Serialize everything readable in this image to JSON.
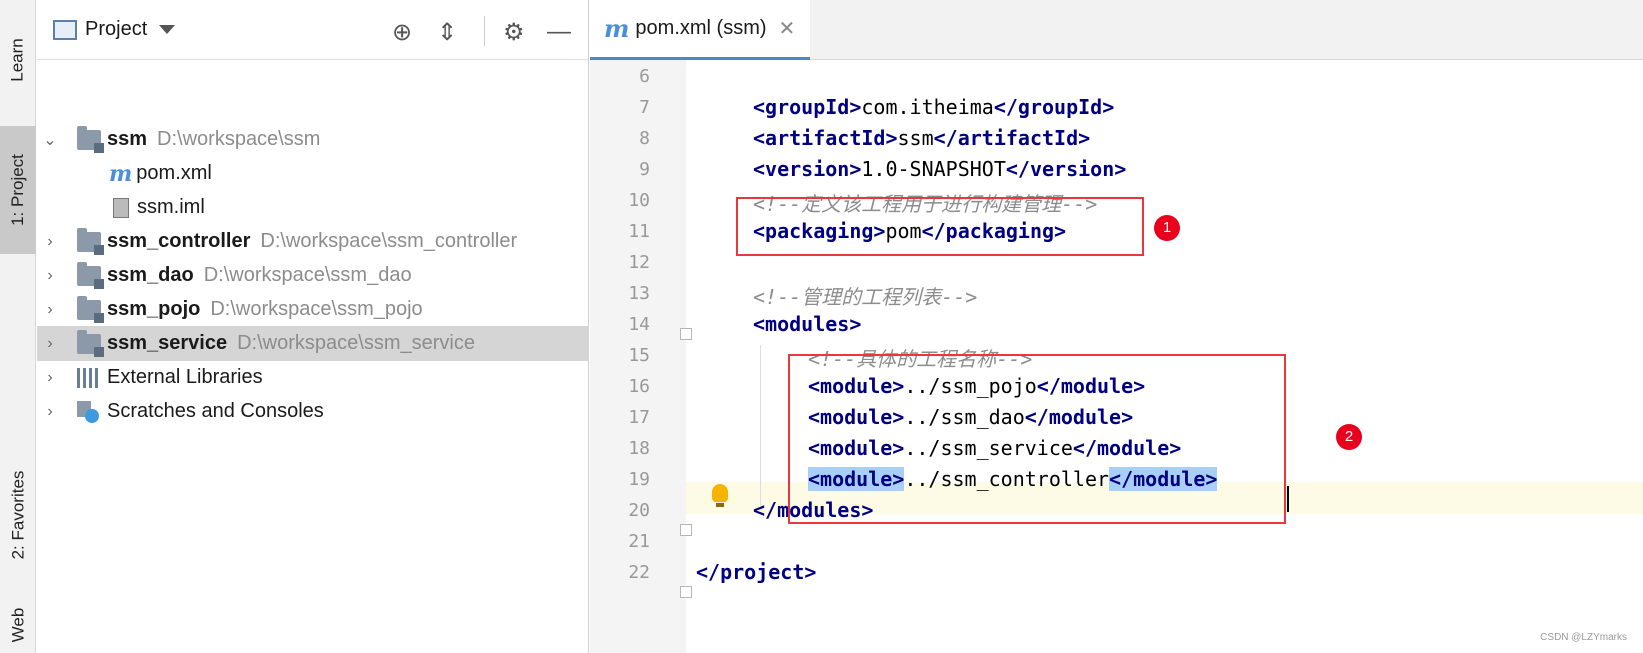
{
  "tool_strip": {
    "learn": "Learn",
    "project": "1: Project",
    "favorites": "2: Favorites",
    "web": "Web"
  },
  "project_panel": {
    "title": "Project",
    "tree": [
      {
        "name": "ssm",
        "path": "D:\\workspace\\ssm",
        "expanded": true
      },
      {
        "name": "pom.xml"
      },
      {
        "name": "ssm.iml"
      },
      {
        "name": "ssm_controller",
        "path": "D:\\workspace\\ssm_controller"
      },
      {
        "name": "ssm_dao",
        "path": "D:\\workspace\\ssm_dao"
      },
      {
        "name": "ssm_pojo",
        "path": "D:\\workspace\\ssm_pojo"
      },
      {
        "name": "ssm_service",
        "path": "D:\\workspace\\ssm_service",
        "selected": true
      },
      {
        "name": "External Libraries"
      },
      {
        "name": "Scratches and Consoles"
      }
    ]
  },
  "editor": {
    "tab_label": "pom.xml (ssm)",
    "tab_icon": "m",
    "line_numbers": [
      "6",
      "7",
      "8",
      "9",
      "10",
      "11",
      "12",
      "13",
      "14",
      "15",
      "16",
      "17",
      "18",
      "19",
      "20",
      "21",
      "22"
    ],
    "code": {
      "l7": {
        "open": "<groupId>",
        "value": "com.itheima",
        "close": "</groupId>"
      },
      "l8": {
        "open": "<artifactId>",
        "value": "ssm",
        "close": "</artifactId>"
      },
      "l9": {
        "open": "<version>",
        "value": "1.0-SNAPSHOT",
        "close": "</version>"
      },
      "l10": "<!--定义该工程用于进行构建管理-->",
      "l11": {
        "open": "<packaging>",
        "value": "pom",
        "close": "</packaging>"
      },
      "l13": "<!--管理的工程列表-->",
      "l14": "<modules>",
      "l15": "<!--具体的工程名称-->",
      "l16": {
        "open": "<module>",
        "value": "../ssm_pojo",
        "close": "</module>"
      },
      "l17": {
        "open": "<module>",
        "value": "../ssm_dao",
        "close": "</module>"
      },
      "l18": {
        "open": "<module>",
        "value": "../ssm_service",
        "close": "</module>"
      },
      "l19": {
        "open": "<module>",
        "value": "../ssm_controller",
        "close": "</module>"
      },
      "l20": "</modules>",
      "l22": "</project>"
    }
  },
  "annotations": {
    "first": "1",
    "second": "2"
  },
  "watermark": "CSDN @LZYmarks",
  "colors": {
    "tag": "#000080",
    "comment": "#8c8c8c",
    "annotation": "#e8383d",
    "selection": "#a8cff5"
  }
}
